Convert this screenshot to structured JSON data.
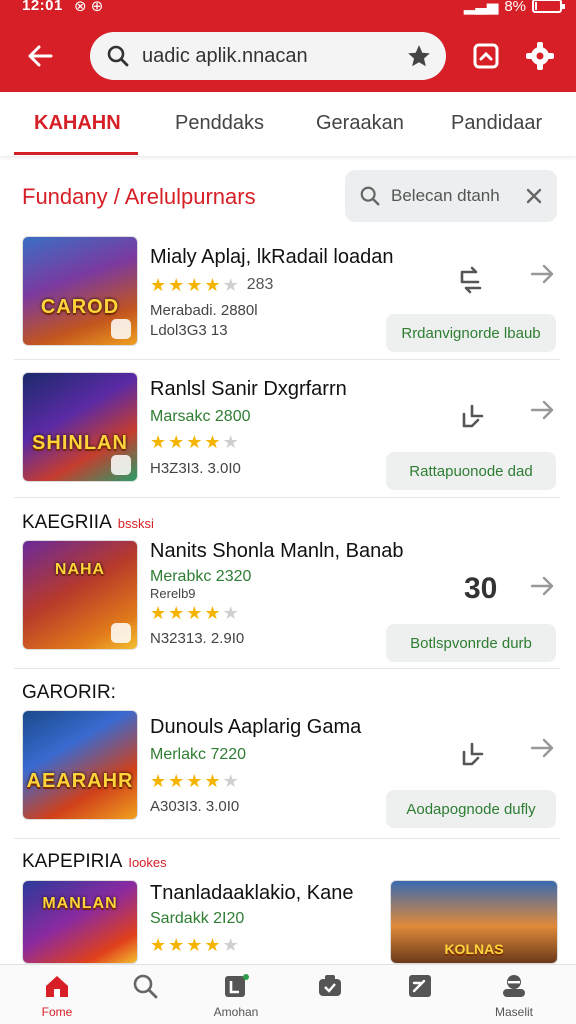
{
  "status": {
    "time": "12:01",
    "battery": "8%",
    "battery_level": 0.08
  },
  "header": {
    "search_query": "uadic aplik.nnacan",
    "brand_color": "#d61f26"
  },
  "tabs": [
    {
      "label": "KAHAHN",
      "active": true
    },
    {
      "label": "Penddaks",
      "active": false
    },
    {
      "label": "Geraakan",
      "active": false
    },
    {
      "label": "Pandidaar",
      "active": false
    }
  ],
  "section": {
    "breadcrumb": "Fundany / Arelulpurnars",
    "filter_text": "Belecan dtanh"
  },
  "items": [
    {
      "thumb_title": "CAROD",
      "title": "Mialy Aplaj, lkRadail loadan",
      "rating": 4,
      "rating_count": "283",
      "sub": "",
      "meta1": "Merabadi. 2880l",
      "meta2": "Ldol3G3 13",
      "action": "Rrdanvignorde lbaub",
      "icon": "swap-icon"
    },
    {
      "thumb_title": "SHINLAN",
      "title": "Ranlsl Sanir Dxgrfarrn",
      "rating": 4,
      "rating_count": "",
      "sub": "Marsakc 2800",
      "meta1": "",
      "meta2": "H3Z3I3. 3.0I0",
      "action": "Rattapuonode dad",
      "icon": "share-icon"
    },
    {
      "category": "KAEGRIIA",
      "category_tag": "bssksi",
      "thumb_title": "NAHA",
      "title": "Nanits Shonla Manln, Banab",
      "rating": 4,
      "rating_count": "",
      "sub": "Merabkc 2320",
      "meta1": "Rerelb9",
      "meta2": "N32313. 2.9I0",
      "action": "Botlspvonrde durb",
      "number": "30"
    },
    {
      "category": "GARORIR:",
      "thumb_title": "AEARAHR",
      "title": "Dunouls Aaplarig Gama",
      "rating": 4,
      "rating_count": "",
      "sub": "Merlakc 7220",
      "meta1": "",
      "meta2": "A303I3. 3.0I0",
      "action": "Aodapognode dufly",
      "icon": "share-icon"
    },
    {
      "category": "KAPEPIRIA",
      "category_tag": "Iookes",
      "thumb_title": "MANLAN",
      "title": "Tnanladaaklakio, Kane",
      "rating": 4,
      "rating_count": "",
      "sub": "Sardakk 2I20",
      "promo_title": "KOLNAS"
    }
  ],
  "bottom_nav": [
    {
      "label": "Fome",
      "icon": "home-icon",
      "active": true
    },
    {
      "label": "",
      "icon": "search-icon",
      "active": false
    },
    {
      "label": "Amohan",
      "icon": "library-icon",
      "active": false
    },
    {
      "label": "",
      "icon": "camera-icon",
      "active": false
    },
    {
      "label": "",
      "icon": "edit-icon",
      "active": false
    },
    {
      "label": "Maselit",
      "icon": "profile-icon",
      "active": false
    }
  ]
}
